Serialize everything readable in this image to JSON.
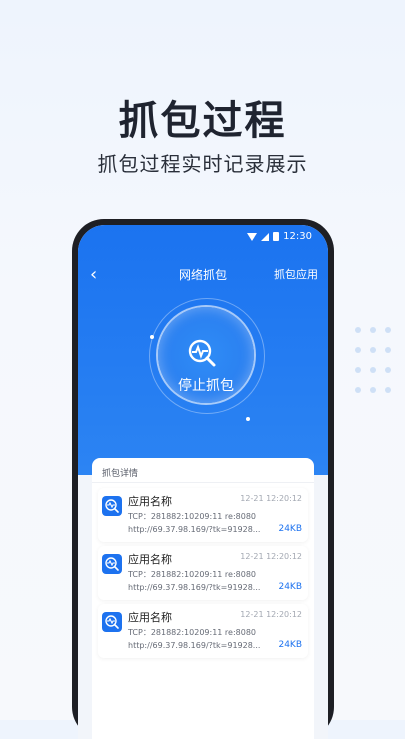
{
  "hero": {
    "title": "抓包过程",
    "subtitle": "抓包过程实时记录展示"
  },
  "status_bar": {
    "time": "12:30"
  },
  "nav": {
    "back_icon": "chevron-left",
    "title": "网络抓包",
    "right_action": "抓包应用"
  },
  "capture_button": {
    "label": "停止抓包",
    "icon": "packet-search-icon"
  },
  "details": {
    "title": "抓包详情",
    "items": [
      {
        "name": "应用名称",
        "time": "12-21 12:20:12",
        "tcp": "TCP：281882:10209:11  re:8080",
        "url": "http://69.37.98.169/?tk=91928...",
        "size": "24KB"
      },
      {
        "name": "应用名称",
        "time": "12-21 12:20:12",
        "tcp": "TCP：281882:10209:11  re:8080",
        "url": "http://69.37.98.169/?tk=91928...",
        "size": "24KB"
      },
      {
        "name": "应用名称",
        "time": "12-21 12:20:12",
        "tcp": "TCP：281882:10209:11  re:8080",
        "url": "http://69.37.98.169/?tk=91928...",
        "size": "24KB"
      }
    ]
  },
  "colors": {
    "accent": "#1b73f0",
    "size_text": "#1d72ef"
  }
}
